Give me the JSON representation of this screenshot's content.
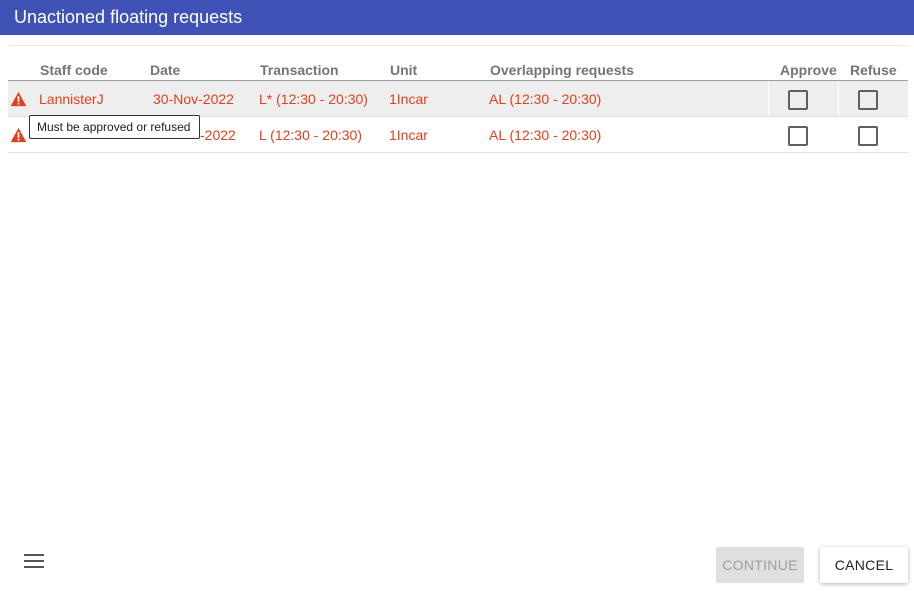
{
  "dialog": {
    "title": "Unactioned floating requests"
  },
  "table": {
    "headers": {
      "staff_code": "Staff code",
      "date": "Date",
      "transaction": "Transaction",
      "unit": "Unit",
      "overlapping": "Overlapping requests",
      "approve": "Approve",
      "refuse": "Refuse"
    },
    "rows": [
      {
        "staff_code": "LannisterJ",
        "date": "30-Nov-2022",
        "transaction": "L* (12:30 - 20:30)",
        "unit": "1Incar",
        "overlapping": "AL (12:30 - 20:30)",
        "approve_checked": false,
        "refuse_checked": false,
        "warning_icon": "warning-triangle-icon"
      },
      {
        "staff_code": "",
        "date": "-2022",
        "transaction": "L (12:30 - 20:30)",
        "unit": "1Incar",
        "overlapping": "AL (12:30 - 20:30)",
        "approve_checked": false,
        "refuse_checked": false,
        "warning_icon": "warning-triangle-icon"
      }
    ]
  },
  "tooltip": {
    "text": "Must be approved or refused"
  },
  "footer": {
    "menu_icon": "hamburger-menu-icon",
    "continue_label": "CONTINUE",
    "cancel_label": "CANCEL"
  },
  "colors": {
    "titlebar": "#3f51b5",
    "error_text": "#e0411b",
    "header_text": "#757575"
  }
}
